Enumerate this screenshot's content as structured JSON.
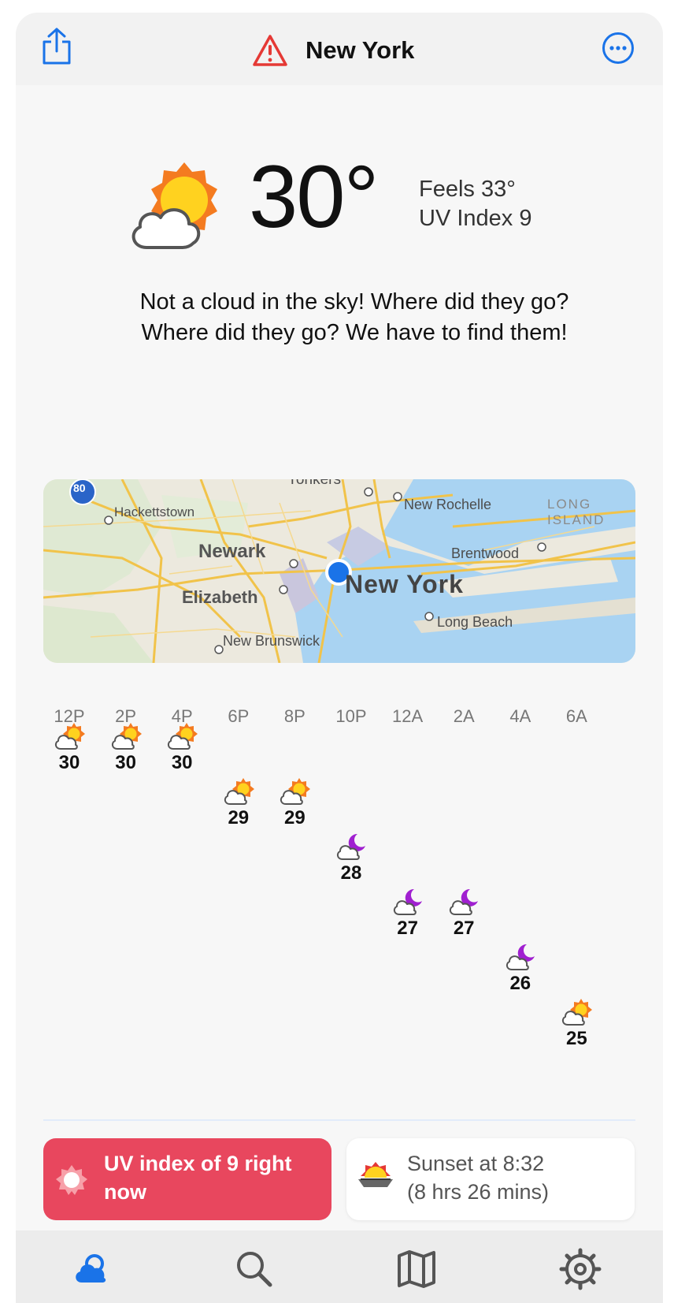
{
  "header": {
    "title": "New York",
    "share_icon": "share-icon",
    "alert_icon": "warning-triangle-icon",
    "more_icon": "more-ellipsis-icon"
  },
  "current": {
    "temperature": "30°",
    "feels_like": "Feels 33°",
    "uv_index": "UV Index 9",
    "condition_icon": "partly-cloudy-sun-icon",
    "description": "Not a cloud in the sky! Where did they go? Where did they go? We have to find them!"
  },
  "map": {
    "labels": {
      "yonkers": "Yonkers",
      "interstate": "80",
      "hackettstown": "Hackettstown",
      "new_rochelle": "New Rochelle",
      "long_island": "LONG\nISLAND",
      "newark": "Newark",
      "brentwood": "Brentwood",
      "new_york": "New York",
      "elizabeth": "Elizabeth",
      "long_beach": "Long Beach",
      "new_brunswick": "New Brunswick"
    }
  },
  "hourly": [
    {
      "time": "12P",
      "temp": "30",
      "icon": "sun-cloud"
    },
    {
      "time": "2P",
      "temp": "30",
      "icon": "sun-cloud"
    },
    {
      "time": "4P",
      "temp": "30",
      "icon": "cloud-sun"
    },
    {
      "time": "6P",
      "temp": "29",
      "icon": "sun-cloud"
    },
    {
      "time": "8P",
      "temp": "29",
      "icon": "sun-cloud"
    },
    {
      "time": "10P",
      "temp": "28",
      "icon": "moon-cloud"
    },
    {
      "time": "12A",
      "temp": "27",
      "icon": "moon-cloud"
    },
    {
      "time": "2A",
      "temp": "27",
      "icon": "moon-cloud"
    },
    {
      "time": "4A",
      "temp": "26",
      "icon": "moon-cloud"
    },
    {
      "time": "6A",
      "temp": "25",
      "icon": "sun-cloud"
    }
  ],
  "cards": {
    "uv": {
      "text": "UV index of 9 right now",
      "icon": "sun-icon",
      "color": "#e8475e"
    },
    "sunset": {
      "line1": "Sunset at 8:32",
      "line2": "(8 hrs 26 mins)",
      "icon": "sunset-icon"
    }
  },
  "tabs": [
    {
      "name": "weather",
      "icon": "weather-icon",
      "active": true
    },
    {
      "name": "search",
      "icon": "search-icon",
      "active": false
    },
    {
      "name": "map",
      "icon": "map-icon",
      "active": false
    },
    {
      "name": "settings",
      "icon": "settings-gear-icon",
      "active": false
    }
  ],
  "colors": {
    "accent": "#1a73e8",
    "alert": "#e53935",
    "moon": "#a020d0",
    "sun": "#f5a623"
  }
}
